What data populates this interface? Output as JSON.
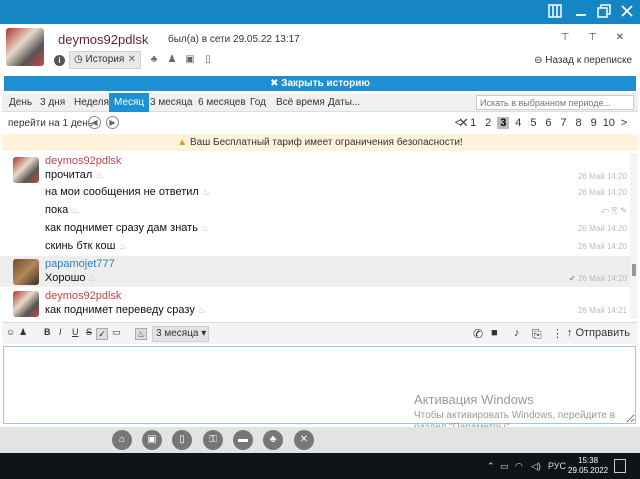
{
  "colors": {
    "accent": "#1e8fd2",
    "titlebar": "#1585c4",
    "author_own": "#c0464e",
    "author_other": "#2a7fbf",
    "warning_bg": "#fff3dc"
  },
  "header": {
    "contact_name": "deymos92pdlsk",
    "status": "был(а) в сети 29.05.22 13:17",
    "history_tab": "История",
    "back_link": "Назад к переписке"
  },
  "close_history": "✖ Закрыть историю",
  "periods": {
    "tabs": [
      "День",
      "3 дня",
      "Неделя",
      "Месяц",
      "3 месяца",
      "6 месяцев",
      "Год",
      "Всё время",
      "Даты..."
    ],
    "active": "Месяц",
    "search_placeholder": "Искать в выбранном периоде..."
  },
  "pager": {
    "goto_label": "перейти на 1 день",
    "prev": "<",
    "pages": [
      "1",
      "2",
      "3",
      "4",
      "5",
      "6",
      "7",
      "8",
      "9",
      "10"
    ],
    "current": "3",
    "next": ">"
  },
  "warning": "Ваш Бесплатный тариф имеет ограничения безопасности!",
  "messages": [
    {
      "author": "deymos92pdlsk",
      "text": "прочитал",
      "time": "26 Май 14:20"
    },
    {
      "author": "",
      "text": "на мои сообщения не ответил",
      "time": "26 Май 14:20"
    },
    {
      "author": "",
      "text": "пока",
      "time": ""
    },
    {
      "author": "",
      "text": "как поднимет сразу дам знать",
      "time": "26 Май 14:20"
    },
    {
      "author": "",
      "text": "скинь бтк кош",
      "time": "26 Май 14:20"
    },
    {
      "author": "papamojet777",
      "text": "Хорошо",
      "time": "26 Май 14:20"
    },
    {
      "author": "deymos92pdlsk",
      "text": "как поднимет переведу сразу",
      "time": "26 Май 14:21"
    }
  ],
  "composer": {
    "format_buttons": [
      "B",
      "I",
      "U",
      "S"
    ],
    "ttl_value": "3 месяца",
    "send_label": "Отправить"
  },
  "activation": {
    "title": "Активация Windows",
    "line1": "Чтобы активировать Windows, перейдите в",
    "line2": "раздел \"Параметры\"."
  },
  "taskbar": {
    "lang": "РУС",
    "time": "15:38",
    "date": "29.05.2022"
  }
}
